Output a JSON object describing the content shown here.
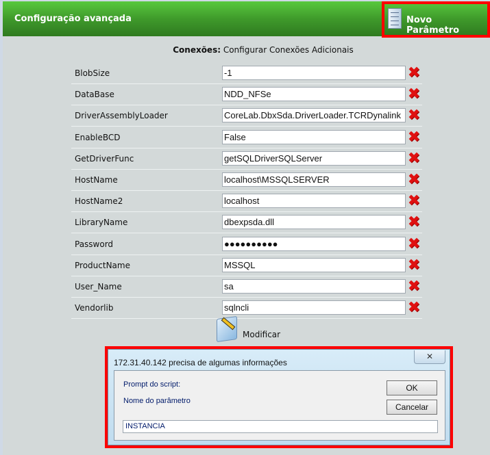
{
  "header": {
    "title": "Configuração avançada",
    "new_param": "Novo Parâmetro"
  },
  "subtitle": {
    "bold": "Conexões:",
    "text": " Configurar Conexões Adicionais"
  },
  "params": [
    {
      "key": "BlobSize",
      "value": "-1"
    },
    {
      "key": "DataBase",
      "value": "NDD_NFSe"
    },
    {
      "key": "DriverAssemblyLoader",
      "value": "CoreLab.DbxSda.DriverLoader.TCRDynalink"
    },
    {
      "key": "EnableBCD",
      "value": "False"
    },
    {
      "key": "GetDriverFunc",
      "value": "getSQLDriverSQLServer"
    },
    {
      "key": "HostName",
      "value": "localhost\\MSSQLSERVER"
    },
    {
      "key": "HostName2",
      "value": "localhost"
    },
    {
      "key": "LibraryName",
      "value": "dbexpsda.dll"
    },
    {
      "key": "Password",
      "value": "●●●●●●●●●●"
    },
    {
      "key": "ProductName",
      "value": "MSSQL"
    },
    {
      "key": "User_Name",
      "value": "sa"
    },
    {
      "key": "Vendorlib",
      "value": "sqlncli"
    }
  ],
  "delete_glyph": "✖",
  "modify_label": "Modificar",
  "dialog": {
    "title": "172.31.40.142 precisa de algumas informações",
    "close": "✕",
    "prompt_label": "Prompt do script:",
    "prompt_text": "Nome do parâmetro",
    "ok": "OK",
    "cancel": "Cancelar",
    "input_value": "INSTANCIA"
  }
}
